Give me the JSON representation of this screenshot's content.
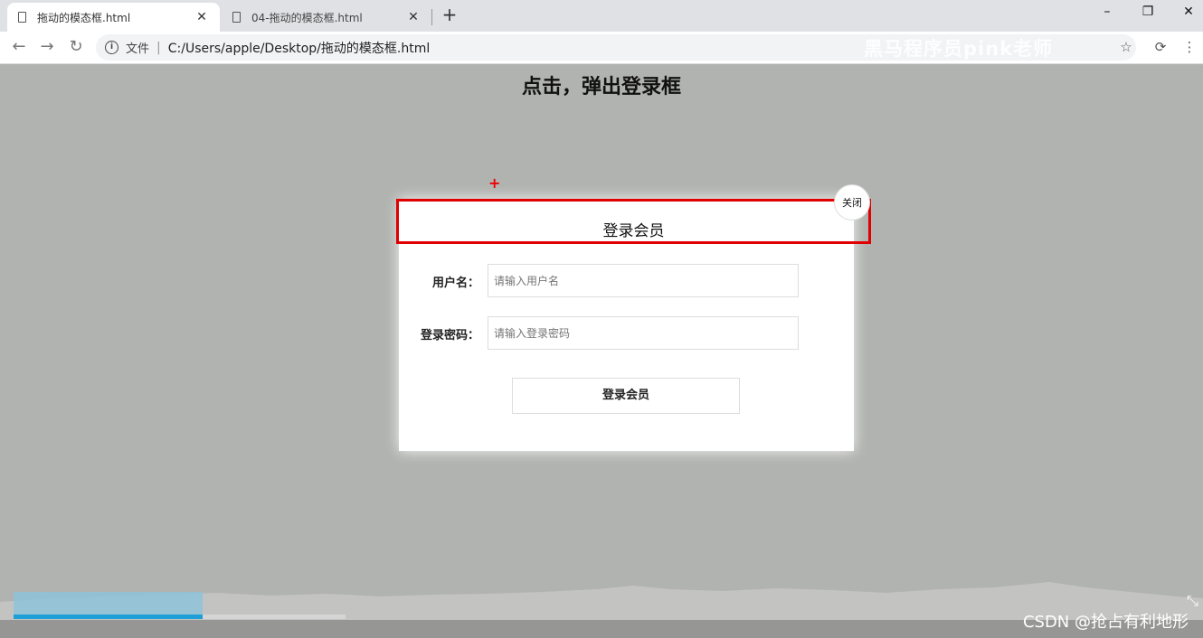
{
  "tabs": [
    {
      "label": "拖动的模态框.html",
      "close": "✕"
    },
    {
      "label": "04-拖动的模态框.html",
      "close": "✕"
    }
  ],
  "new_tab": "+",
  "window_controls": {
    "minimize": "–",
    "restore": "❐",
    "close": "✕"
  },
  "nav": {
    "back": "←",
    "forward": "→",
    "reload": "↻"
  },
  "address": {
    "scheme_label": "文件",
    "separator": "|",
    "url": "C:/Users/apple/Desktop/拖动的模态框.html"
  },
  "watermark": "黑马程序员pink老师",
  "page": {
    "open_link": "点击，弹出登录框",
    "modal": {
      "title": "登录会员",
      "close_label": "关闭",
      "username_label": "用户名：",
      "username_placeholder": "请输入用户名",
      "password_label": "登录密码：",
      "password_placeholder": "请输入登录密码",
      "submit_label": "登录会员"
    }
  },
  "video": {
    "progress": 0.57,
    "buffered": 0.57,
    "credit": "CSDN @抢占有利地形"
  },
  "colors": {
    "highlight_border": "#e00000",
    "progress": "#1e9fd8",
    "overlay_bg": "#b1b3b0"
  }
}
